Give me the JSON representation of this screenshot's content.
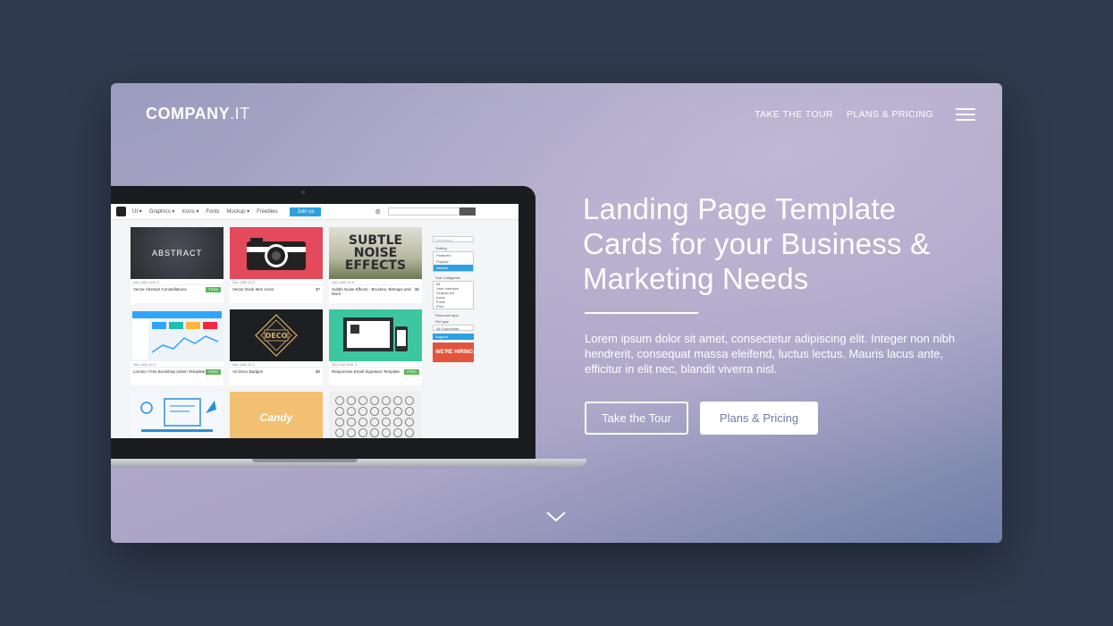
{
  "brand": {
    "name": "COMPANY",
    "suffix": ".IT"
  },
  "nav": {
    "items": [
      "TAKE THE TOUR",
      "PLANS & PRICING"
    ],
    "menu_icon": "hamburger-icon"
  },
  "hero": {
    "headline": "Landing Page Template Cards for your Business & Marketing Needs",
    "lead": "Lorem ipsum dolor sit amet, consectetur adipiscing elit. Integer non nibh hendrerit, consequat massa eleifend, luctus lectus. Mauris lacus ante, efficitur in elit nec, blandit viverra nisl.",
    "primary_button": "Take the Tour",
    "secondary_button": "Plans & Pricing",
    "scroll_icon": "chevron-down-icon"
  },
  "mockup": {
    "menu": [
      "UI ▾",
      "Graphics ▾",
      "Icons ▾",
      "Fonts",
      "Mockup ▾",
      "Freebies"
    ],
    "join": "Join us",
    "cards": [
      {
        "thumb": "ABSTRACT",
        "meta": "Nov 16th  1116  3",
        "title": "Vector Abstract Constellations",
        "tag": "FREE"
      },
      {
        "thumb": "",
        "meta": "Nov 16th  10  3",
        "title": "Vector Desk Item Icons",
        "tag": "$7"
      },
      {
        "thumb": "SUBTLE NOISE EFFECTS",
        "meta": "Nov 16th  10  3",
        "title": "Subtle Noise Effects - Brushes, Bitmaps and More",
        "tag": "$6"
      },
      {
        "thumb": "",
        "meta": "Nov 16th  10  3",
        "title": "Lumino: Free Bootstrap Admin Template",
        "tag": "FREE"
      },
      {
        "thumb": "DECO",
        "meta": "Nov 16th  10  1",
        "title": "Art Deco Badges",
        "tag": "$5"
      },
      {
        "thumb": "",
        "meta": "Nov 2nd  1941  3",
        "title": "Responsive Email Signature Template",
        "tag": "FREE"
      },
      {
        "thumb": "",
        "meta": "",
        "title": "",
        "tag": ""
      },
      {
        "thumb": "Candy",
        "meta": "",
        "title": "",
        "tag": ""
      },
      {
        "thumb": "",
        "meta": "",
        "title": "",
        "tag": ""
      }
    ],
    "sidebar": {
      "search": "Keywords",
      "sorting": "Sorting",
      "sort_options": [
        "Featured",
        "Popular",
        "Newest"
      ],
      "subcat": "Sub-Categories",
      "subcat_options": [
        "All",
        "User Interface",
        "Graphic Art",
        "Icons",
        "Fonts",
        "Print"
      ],
      "resource": "Resource type",
      "file": "File type",
      "downloads": "All Downloads",
      "support": "Support",
      "hiring": "WE'RE HIRING"
    }
  }
}
